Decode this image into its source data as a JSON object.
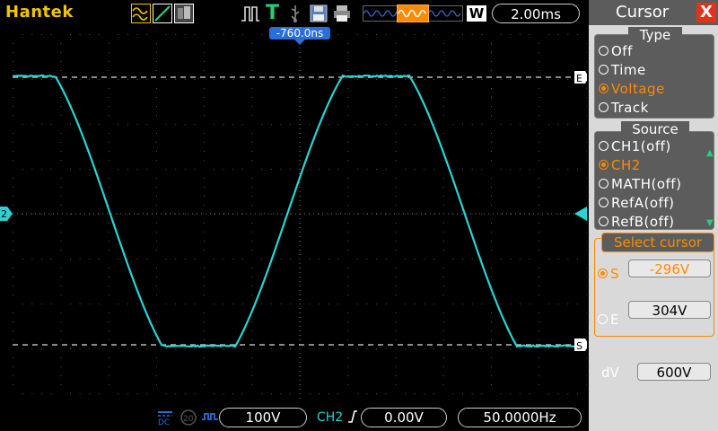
{
  "app": {
    "brand": "Hantek"
  },
  "toolbar": {
    "timebase": "2.00ms",
    "memory_badge": "W",
    "trigger_mode_letter": "T"
  },
  "display": {
    "trigger_time_offset": "-760.0ns",
    "channel_marker": "2",
    "cursor_markers": {
      "end": "E",
      "start": "S"
    }
  },
  "status": {
    "vdiv": "100V",
    "channel": "CH2",
    "trigger_level": "0.00V",
    "frequency": "50.0000Hz",
    "coupling": "DC",
    "bw_limit": "20"
  },
  "panel": {
    "title": "Cursor",
    "close_glyph": "X",
    "type_title": "Type",
    "type_options": [
      {
        "label": "Off",
        "selected": false
      },
      {
        "label": "Time",
        "selected": false
      },
      {
        "label": "Voltage",
        "selected": true
      },
      {
        "label": "Track",
        "selected": false
      }
    ],
    "source_title": "Source",
    "source_options": [
      {
        "label": "CH1(off)",
        "selected": false
      },
      {
        "label": "CH2",
        "selected": true
      },
      {
        "label": "MATH(off)",
        "selected": false
      },
      {
        "label": "RefA(off)",
        "selected": false
      },
      {
        "label": "RefB(off)",
        "selected": false
      }
    ],
    "select_cursor_title": "Select cursor",
    "s_label": "S",
    "s_value": "-296V",
    "e_label": "E",
    "e_value": "304V",
    "dv_label": "dV",
    "dv_value": "600V"
  },
  "colors": {
    "trace": "#2ad4d4",
    "accent": "#ff8a00",
    "brand": "#f3c400",
    "trigger": "#22d07a",
    "time_marker": "#2a6fd8"
  }
}
